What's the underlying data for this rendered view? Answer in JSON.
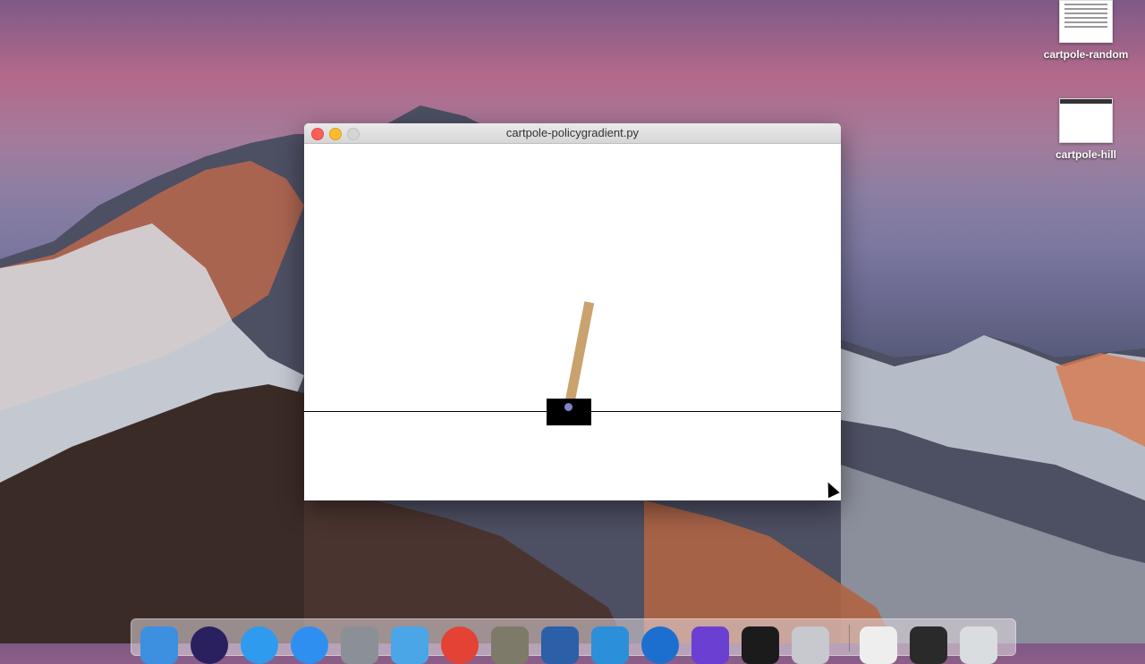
{
  "desktop": {
    "icons": [
      {
        "label": "cartpole-random"
      },
      {
        "label": "cartpole-hill"
      }
    ]
  },
  "window": {
    "title": "cartpole-policygradient.py"
  },
  "dock": {
    "items": [
      "finder-icon",
      "siri-icon",
      "safari-icon",
      "app-store-icon",
      "system-preferences-icon",
      "xcode-icon",
      "chrome-icon",
      "gimp-icon",
      "virtualbox-icon",
      "docker-icon",
      "quicktime-icon",
      "imovie-icon",
      "terminal-icon",
      "launchpad-icon",
      "documents-icon",
      "terminal-window-icon",
      "trash-icon"
    ]
  },
  "colors": {
    "pole": "#caa26e",
    "cart": "#000000",
    "axle": "#8283c8"
  }
}
